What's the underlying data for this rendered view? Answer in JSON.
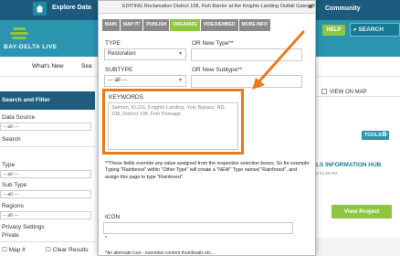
{
  "topbar": {
    "explore_data": "Explore Data",
    "community": "Community"
  },
  "logo": {
    "text": "BAY-DELTA LIVE"
  },
  "header": {
    "help_label": "HELP",
    "search_label": "SEARCH"
  },
  "nav": {
    "whats_new": "What's New",
    "truncated": "Sea"
  },
  "left_panel": {
    "title": "Search and Filter",
    "data_source_label": "Data Source",
    "data_source_value": "-- all ---",
    "search_label": "Search",
    "type_label": "Type",
    "type_value": "-- all ---",
    "subtype_label": "Sub Type",
    "subtype_value": "-- all ---",
    "regions_label": "Regions",
    "regions_value": "-- all ---",
    "privacy_label": "Privacy Settings",
    "privacy_value": "Private",
    "map_it_label": "Map It",
    "clear_results_label": "Clear Results"
  },
  "right_panel": {
    "view_on_map": "VIEW ON MAP",
    "tools_label": "TOOLS",
    "hub_title": "LS INFORMATION HUB",
    "hub_date": "0 03:28 PM",
    "view_project": "View Project"
  },
  "modal": {
    "title": "EDITING Reclamation District 108, Fish Barrier at the Knights Landing Outfall Gates (KLOG)",
    "close_symbol": "×",
    "tabs": [
      {
        "label": "MAIN",
        "active": false
      },
      {
        "label": "MAP IT!",
        "active": false
      },
      {
        "label": "PUBLISH",
        "active": false
      },
      {
        "label": "ORGANIZE",
        "active": true
      },
      {
        "label": "VIDEO/EMBED",
        "active": false
      },
      {
        "label": "MORE INFO",
        "active": false
      }
    ],
    "type_label": "TYPE",
    "type_value": "Restoration",
    "new_type_label": "OR New Type**",
    "subtype_label": "SUBTYPE",
    "subtype_value": "--- all ---",
    "new_subtype_label": "OR New Subtype**",
    "keywords_label": "KEYWORDS",
    "keywords_value": "Salmon, KLOG, Knights Landing, Yolo Bypass, RD-108, District 108, Fish Passage",
    "help_text": "**These fields override any value assigned from the respective selection boxes. So for example: Typing \"Rainforest\" within \"Other Type\" will create a \"NEW\" Type named \"Rainforest\", and assign this page to type \"Rainforest\".",
    "icon_label": "ICON",
    "icon_note": "*",
    "alt_note": "*An alternate icon - overrides content thumbnails etc..."
  },
  "colors": {
    "header_dark": "#1d5a7e",
    "header_teal": "#2b95b0",
    "accent_green": "#8dc63f",
    "tab_gray": "#8a8a8a",
    "highlight_orange": "#e97a1e"
  }
}
